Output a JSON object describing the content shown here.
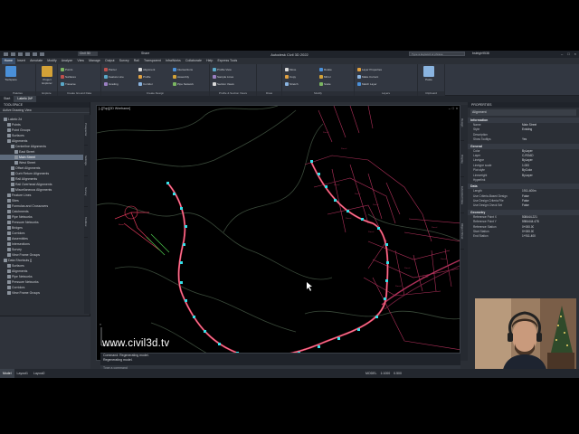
{
  "app": {
    "title": "Autodesk Civil 3D 2022",
    "file_dropdown": "Civil 3D",
    "share_label": "Share",
    "search_placeholder": "Type a keyword or phrase",
    "user": "bsleigh9538",
    "window_controls": [
      "–",
      "□",
      "×"
    ]
  },
  "ribbon": {
    "tabs": [
      "Home",
      "Insert",
      "Annotate",
      "Modify",
      "Analyze",
      "View",
      "Manage",
      "Output",
      "Survey",
      "Rail",
      "Transparent",
      "InfraWorks",
      "Collaborate",
      "Help",
      "Express Tools"
    ],
    "active_tab": "Home",
    "groups": [
      {
        "label": "Palettes",
        "buttons": [
          "Toolspace"
        ]
      },
      {
        "label": "Explore",
        "buttons": [
          "Project Explorer"
        ]
      },
      {
        "label": "Create Ground Data",
        "buttons": [
          "Points",
          "Surfaces",
          "Traverse"
        ]
      },
      {
        "label": "Create Design",
        "buttons": [
          "Parcel",
          "Feature Line",
          "Grading",
          "Alignment",
          "Profile",
          "Corridor",
          "Intersections",
          "Assembly",
          "Pipe Network"
        ]
      },
      {
        "label": "Profile & Section Views",
        "buttons": [
          "Profile View",
          "Sample Lines",
          "Section Views"
        ]
      },
      {
        "label": "Draw",
        "buttons": []
      },
      {
        "label": "Modify",
        "buttons": [
          "Move",
          "Copy",
          "Stretch",
          "Rotate",
          "Mirror",
          "Scale"
        ]
      },
      {
        "label": "Layers",
        "buttons": [
          "Layer Properties",
          "Make Current",
          "Match Layer"
        ]
      },
      {
        "label": "Clipboard",
        "buttons": [
          "Paste"
        ]
      }
    ]
  },
  "doc_tabs": [
    "Start",
    "Lakelo 2d*"
  ],
  "toolspace": {
    "title": "TOOLSPACE",
    "filter": "Active Drawing View",
    "tree": [
      {
        "label": "Lakelo 2d",
        "indent": 1
      },
      {
        "label": "Points",
        "indent": 2
      },
      {
        "label": "Point Groups",
        "indent": 2
      },
      {
        "label": "Surfaces",
        "indent": 2
      },
      {
        "label": "Alignments",
        "indent": 2
      },
      {
        "label": "Centerline Alignments",
        "indent": 3
      },
      {
        "label": "East Street",
        "indent": 4
      },
      {
        "label": "Main Street",
        "indent": 4,
        "selected": true
      },
      {
        "label": "West Street",
        "indent": 4
      },
      {
        "label": "Offset Alignments",
        "indent": 3
      },
      {
        "label": "Curb Return Alignments",
        "indent": 3
      },
      {
        "label": "Rail Alignments",
        "indent": 3
      },
      {
        "label": "Rail Overhead Alignments",
        "indent": 3
      },
      {
        "label": "Miscellaneous Alignments",
        "indent": 3
      },
      {
        "label": "Feature Lines",
        "indent": 2
      },
      {
        "label": "Sites",
        "indent": 2
      },
      {
        "label": "Formulas and Crossovers",
        "indent": 2
      },
      {
        "label": "Catchments",
        "indent": 2
      },
      {
        "label": "Pipe Networks",
        "indent": 2
      },
      {
        "label": "Pressure Networks",
        "indent": 2
      },
      {
        "label": "Bridges",
        "indent": 2
      },
      {
        "label": "Corridors",
        "indent": 2
      },
      {
        "label": "Assemblies",
        "indent": 2
      },
      {
        "label": "Intersections",
        "indent": 2
      },
      {
        "label": "Survey",
        "indent": 2
      },
      {
        "label": "View Frame Groups",
        "indent": 2
      },
      {
        "label": "Data Shortcuts []",
        "indent": 1
      },
      {
        "label": "Surfaces",
        "indent": 2
      },
      {
        "label": "Alignments",
        "indent": 2
      },
      {
        "label": "Pipe Networks",
        "indent": 2
      },
      {
        "label": "Pressure Networks",
        "indent": 2
      },
      {
        "label": "Corridors",
        "indent": 2
      },
      {
        "label": "View Frame Groups",
        "indent": 2
      }
    ],
    "side_tabs": [
      "Prospector",
      "Settings",
      "Survey",
      "Toolbox"
    ]
  },
  "viewport": {
    "label": "[–][Top][2D Wireframe]",
    "controls": [
      "–",
      "□",
      "×"
    ],
    "watermark": "www.civil3d.tv"
  },
  "mid_tabs": [
    "Design",
    "Display",
    "Extended Data",
    "Object Sheet"
  ],
  "properties": {
    "title": "PROPERTIES",
    "selection": "Alignment",
    "categories": [
      {
        "name": "Information",
        "rows": [
          {
            "key": "Name",
            "value": "Main Street"
          },
          {
            "key": "Style",
            "value": "Existing"
          },
          {
            "key": "Description",
            "value": ""
          },
          {
            "key": "Show Tooltips",
            "value": "Yes"
          }
        ]
      },
      {
        "name": "General",
        "rows": [
          {
            "key": "Color",
            "value": "ByLayer"
          },
          {
            "key": "Layer",
            "value": "C-ROAD"
          },
          {
            "key": "Linetype",
            "value": "ByLayer"
          },
          {
            "key": "Linetype scale",
            "value": "1.000"
          },
          {
            "key": "Plot style",
            "value": "ByColor"
          },
          {
            "key": "Lineweight",
            "value": "ByLayer"
          },
          {
            "key": "Hyperlink",
            "value": ""
          }
        ]
      },
      {
        "name": "Data",
        "rows": [
          {
            "key": "Length",
            "value": "1911.400m"
          },
          {
            "key": "Use Criteria-Based Design",
            "value": "False"
          },
          {
            "key": "Use Design Criteria File",
            "value": "False"
          },
          {
            "key": "Use Design Check Set",
            "value": "False"
          }
        ]
      },
      {
        "name": "Geometry",
        "rows": [
          {
            "key": "Reference Point X",
            "value": "508444.221"
          },
          {
            "key": "Reference Point Y",
            "value": "5984444.478"
          },
          {
            "key": "Reference Station",
            "value": "0+000.00"
          },
          {
            "key": "Start Station",
            "value": "0+000.00"
          },
          {
            "key": "End Station",
            "value": "1+911.400"
          }
        ]
      }
    ]
  },
  "command": {
    "history": [
      "Command: Regenerating model.",
      "Regenerating model."
    ],
    "prompt": "Type a command"
  },
  "statusbar": {
    "layout_tabs": [
      "Model",
      "Layout1",
      "Layout2"
    ],
    "active_layout": "Model",
    "right_items": [
      "MODEL",
      "1:1000",
      "0.500"
    ]
  },
  "colors": {
    "alignment": "#e0385a",
    "alignment_core": "#ff9fb4",
    "pi_markers": "#35e0e8",
    "parcels": "#b0305a",
    "contours": "#3a4a3a",
    "highlight": "#00c0ff"
  }
}
